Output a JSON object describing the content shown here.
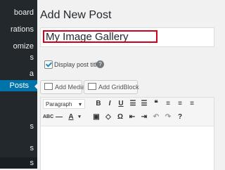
{
  "sidebar": {
    "items": [
      {
        "label": "board"
      },
      {
        "label": "rations"
      },
      {
        "label": "omize"
      },
      {
        "label": "s"
      },
      {
        "label": "a"
      },
      {
        "label": "Posts"
      },
      {
        "label": "s"
      },
      {
        "label": "s"
      },
      {
        "label": "s"
      }
    ]
  },
  "page": {
    "title": "Add New Post",
    "post_title_value": "My Image Gallery",
    "display_post_title_label": "Display post title",
    "help_glyph": "?"
  },
  "buttons": {
    "add_media": "Add Media",
    "add_gridblock": "Add GridBlock"
  },
  "editor": {
    "format_select": "Paragraph",
    "row1_icons": [
      "bold-icon",
      "italic-icon",
      "underline-icon",
      "list-icon",
      "numbered-list-icon",
      "blockquote-icon",
      "align-left-icon",
      "align-center-icon",
      "align-right-icon"
    ],
    "row2_icons": [
      "strikethrough-icon",
      "hr-icon",
      "text-color-icon",
      "paste-text-icon",
      "clear-format-icon",
      "special-char-icon",
      "outdent-icon",
      "indent-icon",
      "undo-icon",
      "redo-icon",
      "help-icon"
    ]
  }
}
